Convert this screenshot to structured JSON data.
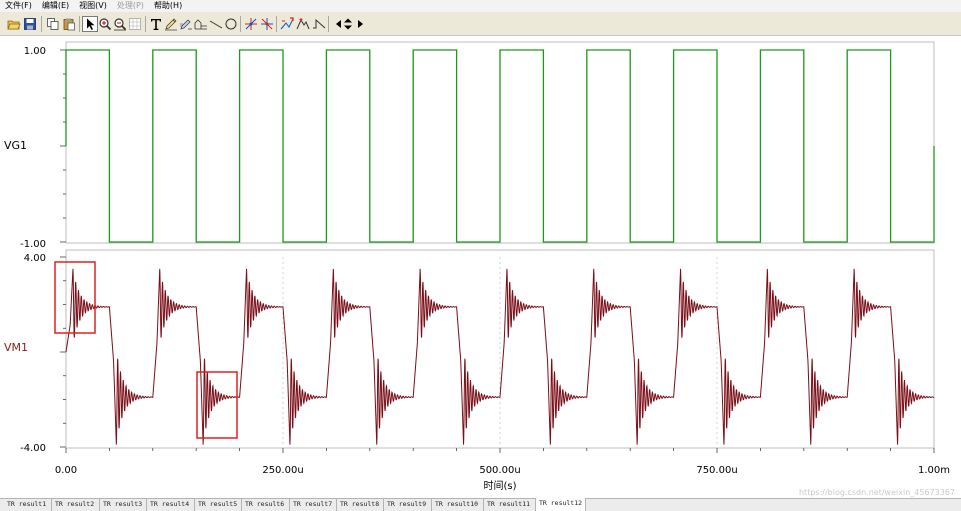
{
  "menubar": {
    "items": [
      {
        "label": "文件(F)",
        "disabled": false
      },
      {
        "label": "编辑(E)",
        "disabled": false
      },
      {
        "label": "视图(V)",
        "disabled": false
      },
      {
        "label": "处理(P)",
        "disabled": true
      },
      {
        "label": "帮助(H)",
        "disabled": false
      }
    ]
  },
  "toolbar": {
    "buttons": [
      {
        "name": "open-icon",
        "x": 6
      },
      {
        "name": "save-icon",
        "x": 22
      },
      {
        "sep": true,
        "x": 41
      },
      {
        "name": "copy-icon",
        "x": 45
      },
      {
        "name": "paste-icon",
        "x": 61
      },
      {
        "sep": true,
        "x": 79
      },
      {
        "name": "pointer-icon",
        "x": 82,
        "pressed": true
      },
      {
        "name": "zoom-in-icon",
        "x": 97
      },
      {
        "name": "zoom-out-icon",
        "x": 112
      },
      {
        "name": "grid-icon",
        "x": 127
      },
      {
        "sep": true,
        "x": 145
      },
      {
        "name": "text-icon",
        "x": 148
      },
      {
        "name": "pencil-icon",
        "x": 163
      },
      {
        "name": "draw-tool-icon",
        "x": 178
      },
      {
        "name": "shape-icon",
        "x": 193
      },
      {
        "name": "line-icon",
        "x": 208
      },
      {
        "name": "circle-icon",
        "x": 223
      },
      {
        "sep": true,
        "x": 240
      },
      {
        "name": "cursor-a-icon",
        "x": 243
      },
      {
        "name": "cursor-b-icon",
        "x": 259
      },
      {
        "sep": true,
        "x": 276
      },
      {
        "name": "marker-icon",
        "x": 279
      },
      {
        "name": "peak-icon",
        "x": 295
      },
      {
        "name": "step-icon",
        "x": 311
      },
      {
        "sep": true,
        "x": 328
      },
      {
        "name": "arrow-left-icon",
        "x": 331
      },
      {
        "name": "arrow-updown-icon",
        "x": 340
      },
      {
        "name": "arrow-right-icon",
        "x": 352
      }
    ]
  },
  "plot": {
    "top_panel": {
      "label": "VG1",
      "y_max_label": "1.00",
      "y_min_label": "-1.00",
      "color": "#1a9a1a"
    },
    "bottom_panel": {
      "label": "VM1",
      "y_max_label": "4.00",
      "y_min_label": "-4.00",
      "color": "#7a0e16"
    },
    "x_ticks": [
      "0.00",
      "250.00u",
      "500.00u",
      "750.00u",
      "1.00m"
    ],
    "x_label": "时间(s)",
    "highlight_color": "#e02020"
  },
  "chart_data": [
    {
      "type": "line",
      "title": "",
      "series": [
        {
          "name": "VG1",
          "x": [
            0,
            0,
            50,
            50,
            100,
            100,
            150,
            150,
            200,
            200,
            250,
            250,
            300,
            300,
            350,
            350,
            400,
            400,
            450,
            450,
            500,
            500,
            550,
            550,
            600,
            600,
            650,
            650,
            700,
            700,
            750,
            750,
            800,
            800,
            850,
            850,
            900,
            900,
            950,
            950,
            1000,
            1000
          ],
          "y": [
            0,
            1,
            1,
            -1,
            -1,
            1,
            1,
            -1,
            -1,
            1,
            1,
            -1,
            -1,
            1,
            1,
            -1,
            -1,
            1,
            1,
            -1,
            -1,
            1,
            1,
            -1,
            -1,
            1,
            1,
            -1,
            -1,
            1,
            1,
            -1,
            -1,
            1,
            1,
            -1,
            -1,
            1,
            1,
            -1,
            -1,
            0
          ]
        }
      ],
      "xlabel": "时间(s)",
      "ylabel": "VG1",
      "xlim": [
        0,
        1000
      ],
      "ylim": [
        -1,
        1
      ],
      "x_unit": "us",
      "grid": false
    },
    {
      "type": "line",
      "title": "",
      "series": [
        {
          "name": "VM1",
          "period_us": 100,
          "high_level": 1.9,
          "low_level": -1.9,
          "overshoot_peak": 3.5,
          "undershoot_peak": -3.9,
          "ringing_decay_us": 25,
          "rise_time_us": 8
        }
      ],
      "xlabel": "时间(s)",
      "ylabel": "VM1",
      "xlim": [
        0,
        1000
      ],
      "ylim": [
        -4,
        4
      ],
      "x_unit": "us",
      "grid": true
    }
  ],
  "result_tabs": [
    "TR result1",
    "TR result2",
    "TR result3",
    "TR result4",
    "TR result5",
    "TR result6",
    "TR result7",
    "TR result8",
    "TR result9",
    "TR result10",
    "TR result11",
    "TR result12"
  ],
  "active_tab_index": 11,
  "watermark": "https://blog.csdn.net/weixin_45673367"
}
